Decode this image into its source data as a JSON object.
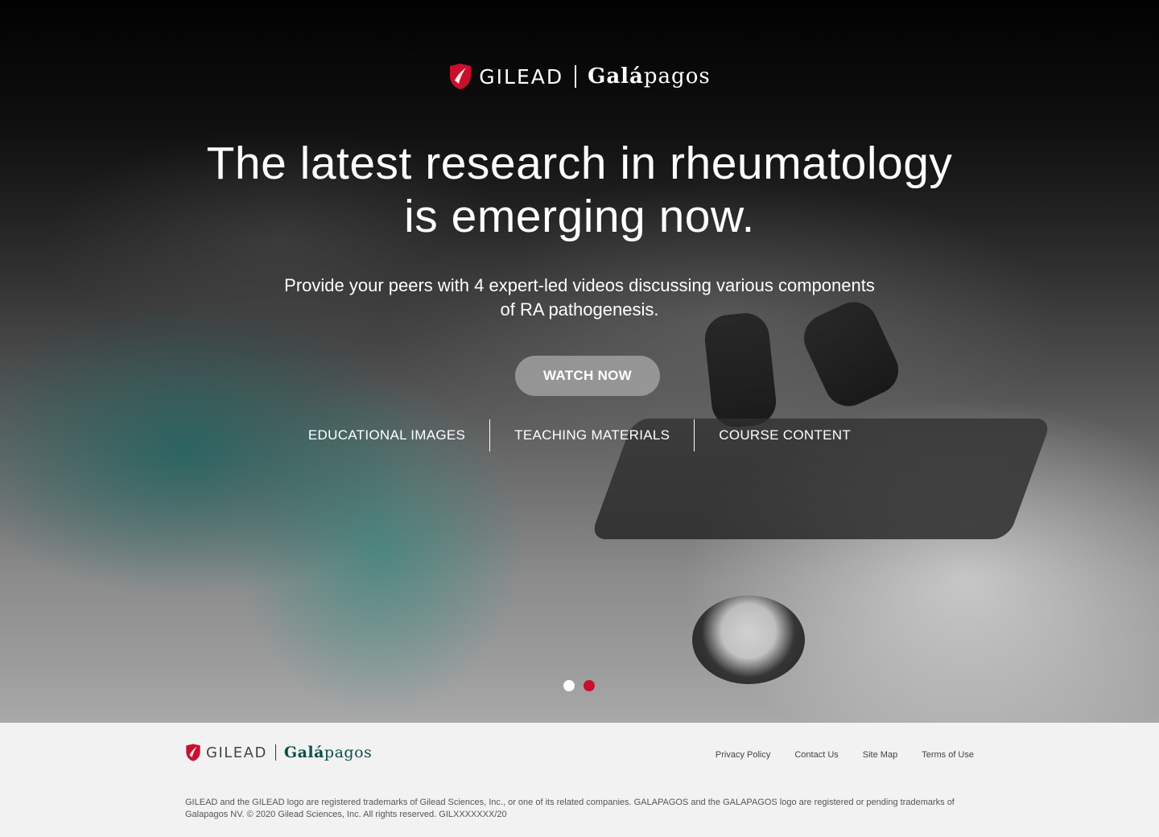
{
  "brand": {
    "gilead": "GILEAD",
    "galapagos_bold": "Galá",
    "galapagos_rest": "pagos"
  },
  "hero": {
    "headline_line1": "The latest research in rheumatology",
    "headline_line2": "is emerging now.",
    "subtext_line1": "Provide your peers with 4 expert-led videos discussing various components",
    "subtext_line2": "of RA pathogenesis.",
    "watch_button": "WATCH NOW",
    "links": [
      "EDUCATIONAL IMAGES",
      "TEACHING MATERIALS",
      "COURSE CONTENT"
    ],
    "carousel": {
      "total": 2,
      "active_index": 2
    }
  },
  "footer": {
    "nav": [
      "Privacy Policy",
      "Contact Us",
      "Site Map",
      "Terms of Use"
    ],
    "legal": "GILEAD and the GILEAD logo are registered trademarks of Gilead Sciences, Inc., or one of its related companies. GALAPAGOS and the GALAPAGOS logo are registered or pending trademarks of Galapagos NV. © 2020 Gilead Sciences, Inc. All rights reserved. GILXXXXXXX/20"
  },
  "colors": {
    "accent_red": "#c8102e",
    "galapagos_teal": "#0c4f4a",
    "dot_inactive": "#ffffff",
    "footer_bg": "#f2f2f2"
  }
}
